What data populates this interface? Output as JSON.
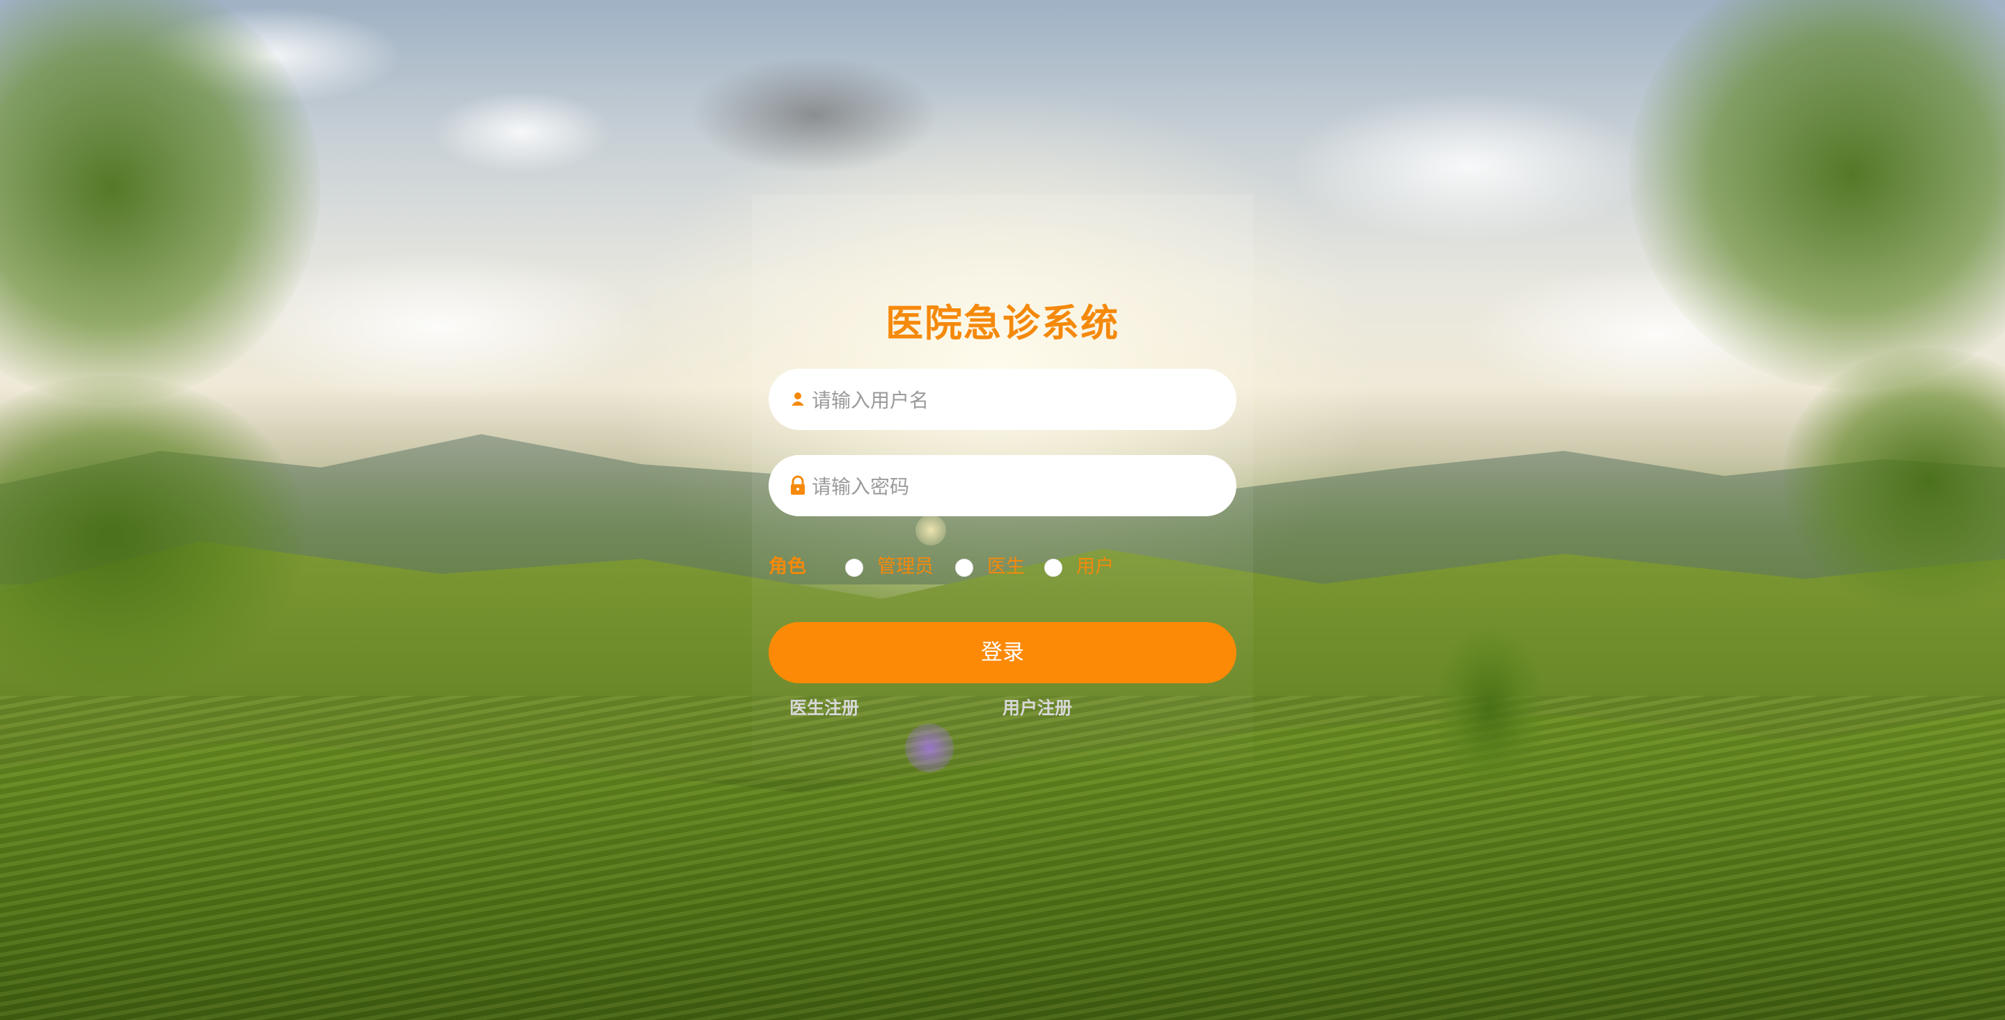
{
  "title": "医院急诊系统",
  "login": {
    "username_placeholder": "请输入用户名",
    "password_placeholder": "请输入密码",
    "role_label": "角色",
    "roles": [
      {
        "label": "管理员",
        "selected": false
      },
      {
        "label": "医生",
        "selected": false
      },
      {
        "label": "用户",
        "selected": false
      }
    ],
    "submit_label": "登录",
    "doctor_register": "医生注册",
    "user_register": "用户注册"
  },
  "icons": {
    "username": "user-icon",
    "password": "lock-icon"
  },
  "colors": {
    "accent": "#fc8a07",
    "title": "#f5890b",
    "register_link": "#d7d7d7"
  }
}
